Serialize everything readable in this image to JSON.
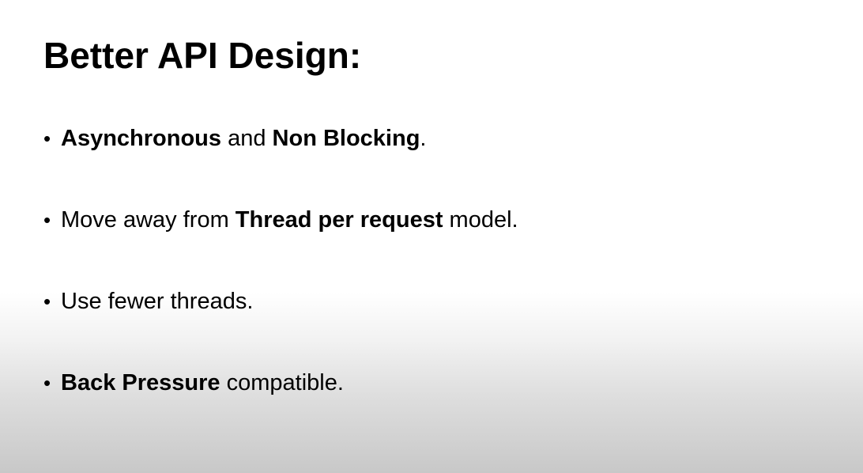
{
  "slide": {
    "title": "Better API Design:",
    "bullet_glyph": "•",
    "bullets": [
      {
        "parts": [
          {
            "text": "Asynchronous",
            "bold": true
          },
          {
            "text": " and ",
            "bold": false
          },
          {
            "text": "Non Blocking",
            "bold": true
          },
          {
            "text": ".",
            "bold": false
          }
        ]
      },
      {
        "parts": [
          {
            "text": "Move away from ",
            "bold": false
          },
          {
            "text": "Thread per request",
            "bold": true
          },
          {
            "text": " model.",
            "bold": false
          }
        ]
      },
      {
        "parts": [
          {
            "text": "Use fewer threads.",
            "bold": false
          }
        ]
      },
      {
        "parts": [
          {
            "text": "Back Pressure",
            "bold": true
          },
          {
            "text": " compatible.",
            "bold": false
          }
        ]
      }
    ]
  }
}
